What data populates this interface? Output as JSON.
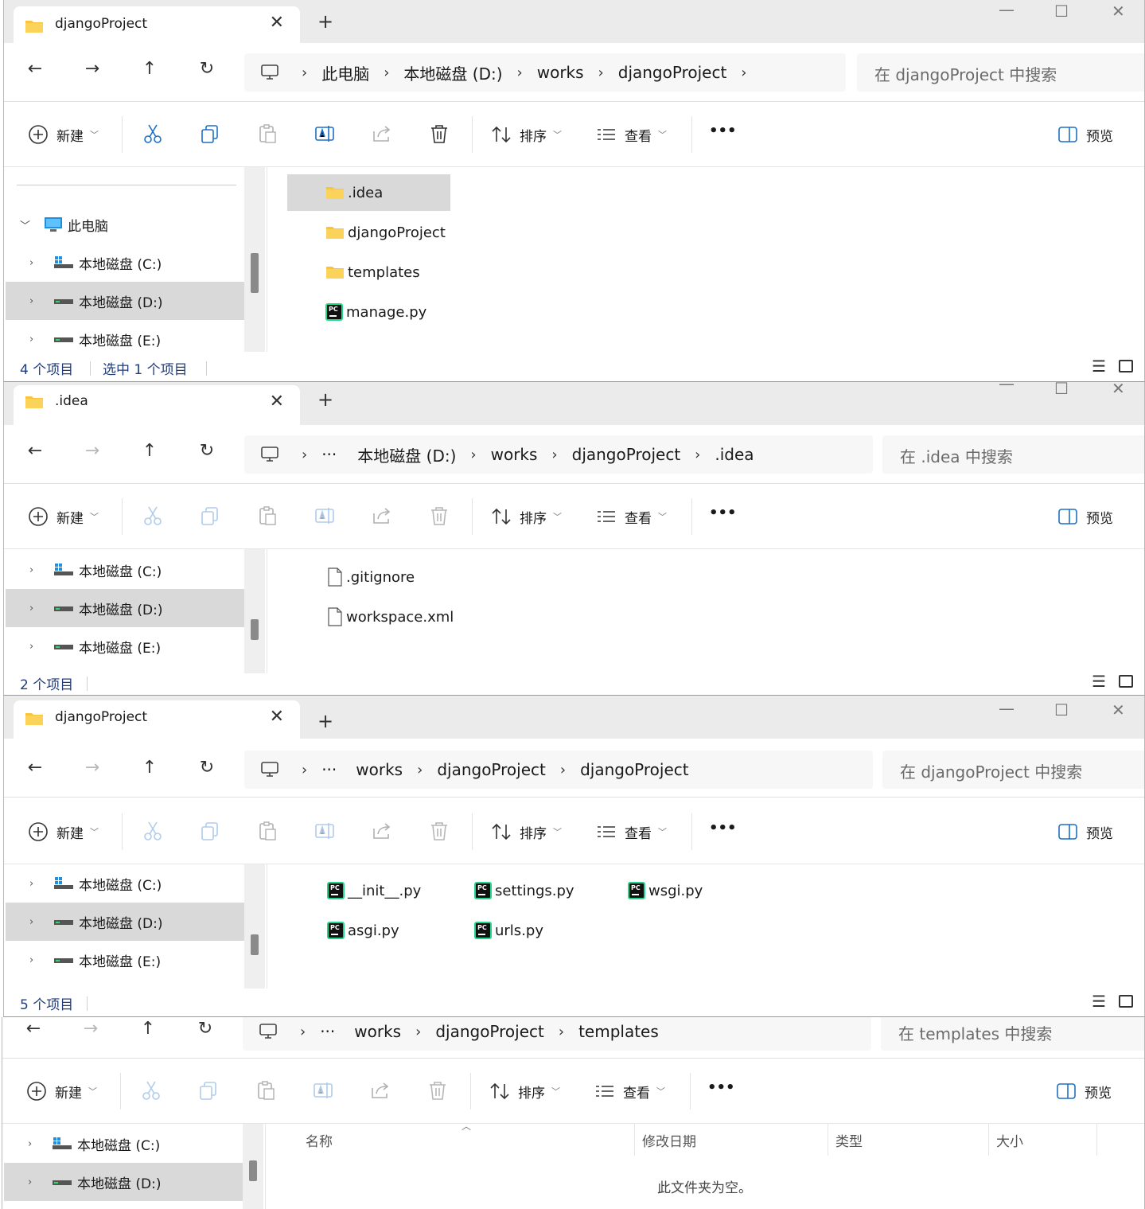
{
  "common": {
    "new_label": "新建",
    "sort_label": "排序",
    "view_label": "查看",
    "more_label": "•••",
    "preview_label": "预览",
    "close_glyph": "✕",
    "new_tab_glyph": "+",
    "minimize_glyph": "—",
    "maximize_glyph": "☐",
    "back_glyph": "←",
    "forward_glyph": "→",
    "up_glyph": "↑",
    "refresh_glyph": "↻",
    "crumb_sep": "›",
    "ellipsis": "···",
    "drive_c": "本地磁盘 (C:)",
    "drive_d": "本地磁盘 (D:)",
    "drive_e": "本地磁盘 (E:)"
  },
  "win1": {
    "tab_title": "djangoProject",
    "crumbs": [
      "此电脑",
      "本地磁盘 (D:)",
      "works",
      "djangoProject"
    ],
    "search_placeholder": "在 djangoProject 中搜索",
    "sidebar_pc": "此电脑",
    "files": [
      ".idea",
      "djangoProject",
      "templates",
      "manage.py"
    ],
    "status_count": "4 个项目",
    "status_selected": "选中 1 个项目"
  },
  "win2": {
    "tab_title": ".idea",
    "crumbs": [
      "本地磁盘 (D:)",
      "works",
      "djangoProject",
      ".idea"
    ],
    "search_placeholder": "在 .idea 中搜索",
    "files": [
      ".gitignore",
      "workspace.xml"
    ],
    "status_count": "2 个项目"
  },
  "win3": {
    "tab_title": "djangoProject",
    "crumbs": [
      "works",
      "djangoProject",
      "djangoProject"
    ],
    "search_placeholder": "在 djangoProject 中搜索",
    "files": [
      "__init__.py",
      "settings.py",
      "wsgi.py",
      "asgi.py",
      "urls.py"
    ],
    "status_count": "5 个项目"
  },
  "win4": {
    "crumbs": [
      "works",
      "djangoProject",
      "templates"
    ],
    "search_placeholder": "在 templates 中搜索",
    "columns": [
      "名称",
      "修改日期",
      "类型",
      "大小"
    ],
    "empty_message": "此文件夹为空。"
  },
  "colors": {
    "folder": "#f8c43c",
    "selection": "#d9d9d9",
    "pycharm": "#21d789",
    "status_text": "#1f3d7a"
  }
}
